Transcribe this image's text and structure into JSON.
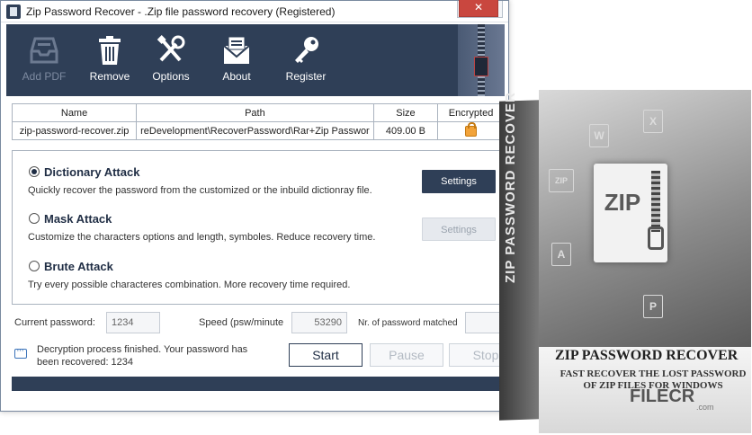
{
  "window": {
    "title": "Zip Password Recover - .Zip file password recovery (Registered)",
    "min_label": "–",
    "max_label": "□",
    "close_label": "✕"
  },
  "toolbar": {
    "items": [
      {
        "label": "Add PDF",
        "icon": "inbox-tray-icon",
        "enabled": false
      },
      {
        "label": "Remove",
        "icon": "trash-icon",
        "enabled": true
      },
      {
        "label": "Options",
        "icon": "wrench-screwdriver-icon",
        "enabled": true
      },
      {
        "label": "About",
        "icon": "envelope-icon",
        "enabled": true
      },
      {
        "label": "Register",
        "icon": "key-icon",
        "enabled": true
      }
    ]
  },
  "file_table": {
    "headers": [
      "Name",
      "Path",
      "Size",
      "Encrypted"
    ],
    "rows": [
      {
        "name": "zip-password-recover.zip",
        "path": "reDevelopment\\RecoverPassword\\Rar+Zip Passwor",
        "size": "409.00 B",
        "encrypted_icon": "lock-icon"
      }
    ]
  },
  "attacks": [
    {
      "title": "Dictionary Attack",
      "desc": "Quickly recover the password from the customized or the inbuild dictionray file.",
      "selected": true,
      "settings_label": "Settings",
      "settings_enabled": true
    },
    {
      "title": "Mask Attack",
      "desc": "Customize the characters options and length, symboles. Reduce recovery time.",
      "selected": false,
      "settings_label": "Settings",
      "settings_enabled": false
    },
    {
      "title": "Brute Attack",
      "desc": "Try every possible characteres combination. More recovery time required.",
      "selected": false
    }
  ],
  "status": {
    "current_label": "Current password:",
    "current_value": "1234",
    "speed_label": "Speed (psw/minute",
    "speed_value": "53290",
    "matched_label": "Nr. of password matched",
    "matched_value": ""
  },
  "message": "Decryption process finished. Your password has been recovered: 1234",
  "actions": {
    "start": "Start",
    "pause": "Pause",
    "stop": "Stop"
  },
  "product_box": {
    "spine_text": "ZIP PASSWORD RECOVER",
    "doc_text": "ZIP",
    "title": "ZIP PASSWORD RECOVER",
    "subtitle": "FAST RECOVER THE LOST PASSWORD OF ZIP FILES FOR WINDOWS",
    "mini_icons": [
      "W",
      "X",
      "ZIP",
      "A",
      "P"
    ]
  },
  "watermark": {
    "brand": "FILECR",
    "domain": ".com"
  },
  "colors": {
    "navy": "#2f3f57",
    "close_red": "#c9473f",
    "lock_orange": "#f2a33a"
  }
}
